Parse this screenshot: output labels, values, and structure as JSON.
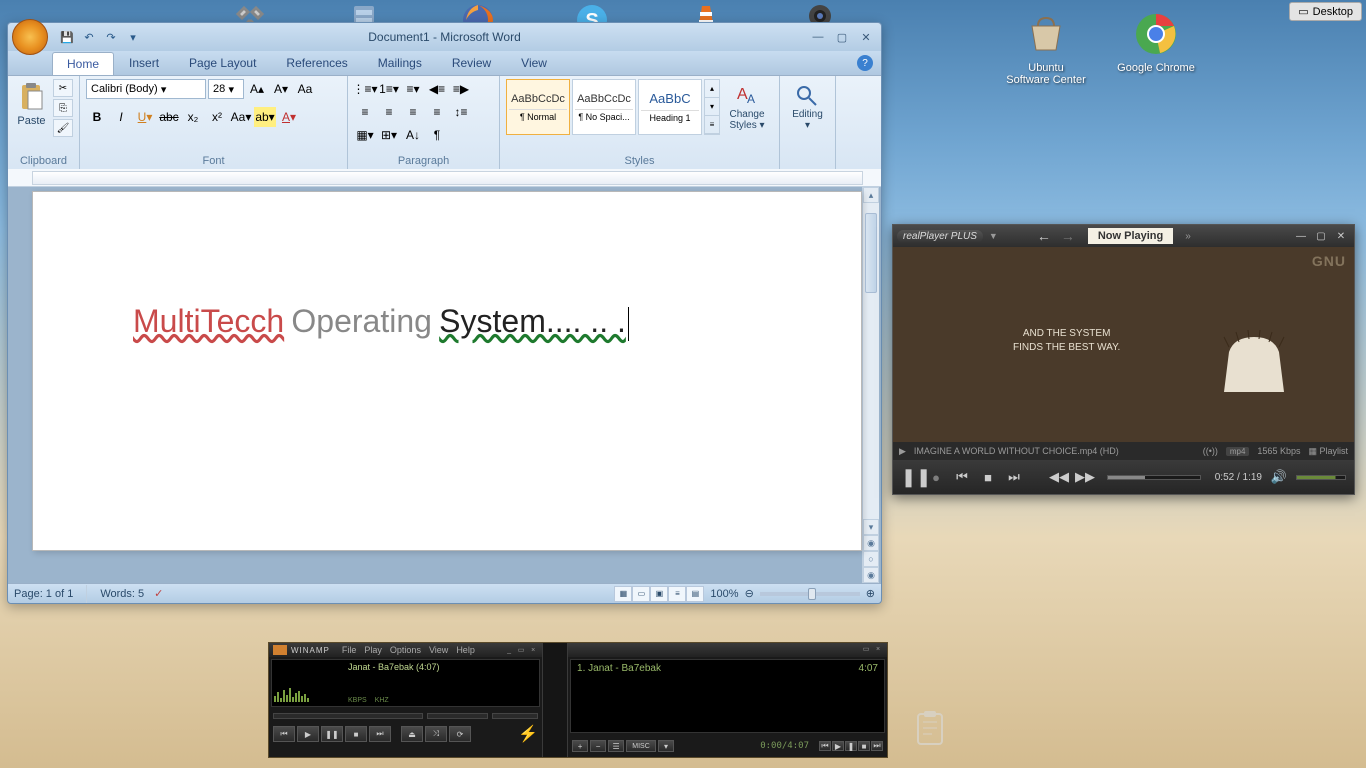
{
  "desktop_button": "Desktop",
  "desktop_icons": [
    {
      "label": "Ubuntu Software Center"
    },
    {
      "label": "Google Chrome"
    }
  ],
  "word": {
    "title": "Document1 - Microsoft Word",
    "tabs": [
      "Home",
      "Insert",
      "Page Layout",
      "References",
      "Mailings",
      "Review",
      "View"
    ],
    "active_tab": "Home",
    "clipboard": {
      "paste": "Paste",
      "label": "Clipboard"
    },
    "font": {
      "name": "Calibri (Body)",
      "size": "28",
      "label": "Font"
    },
    "paragraph": {
      "label": "Paragraph"
    },
    "styles": {
      "items": [
        {
          "preview": "AaBbCcDc",
          "label": "¶ Normal"
        },
        {
          "preview": "AaBbCcDc",
          "label": "¶ No Spaci..."
        },
        {
          "preview": "AaBbC",
          "label": "Heading 1"
        }
      ],
      "change": "Change Styles",
      "label": "Styles"
    },
    "editing": {
      "label": "Editing"
    },
    "document": {
      "word1": "MultiTecch",
      "word2": "Operating",
      "word3": "System.... .. ."
    },
    "status": {
      "page": "Page: 1 of 1",
      "words": "Words: 5",
      "zoom": "100%"
    }
  },
  "realplayer": {
    "logo": "realPlayer PLUS",
    "tab": "Now Playing",
    "video_text_1": "AND THE SYSTEM",
    "video_text_2": "FINDS THE BEST WAY.",
    "corner": "GNU",
    "filename": "IMAGINE A WORLD WITHOUT CHOICE.mp4 (HD)",
    "format": "mp4",
    "bitrate": "1565 Kbps",
    "playlist": "Playlist",
    "time": "0:52 / 1:19"
  },
  "winamp": {
    "title": "WINAMP",
    "menu": [
      "File",
      "Play",
      "Options",
      "View",
      "Help"
    ],
    "track": "Janat - Ba7ebak (4:07)",
    "kbps_label": "KBPS",
    "khz_label": "KHZ",
    "playlist_item": "1. Janat - Ba7ebak",
    "playlist_duration": "4:07",
    "pl_time": "0:00/4:07",
    "misc": "MISC"
  }
}
